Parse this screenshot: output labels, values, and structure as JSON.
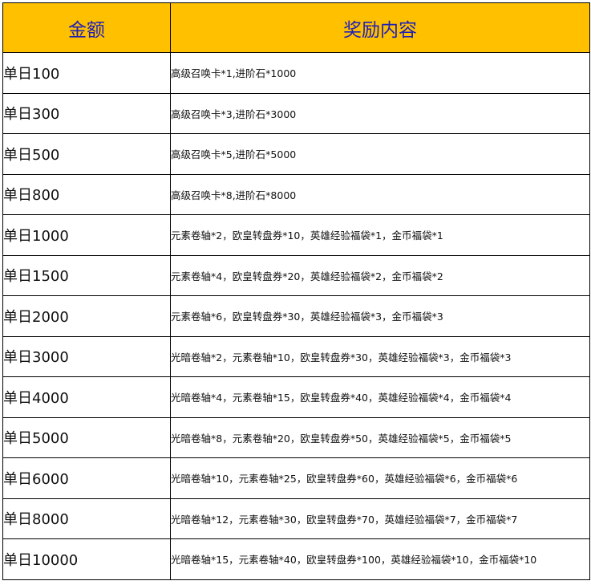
{
  "header": {
    "amount_label": "金额",
    "reward_label": "奖励内容"
  },
  "colors": {
    "header_bg": "#ffc000",
    "header_text": "#1f1fb8",
    "border": "#000000"
  },
  "rows": [
    {
      "amount": "单日100",
      "reward": "高级召唤卡*1,进阶石*1000"
    },
    {
      "amount": "单日300",
      "reward": "高级召唤卡*3,进阶石*3000"
    },
    {
      "amount": "单日500",
      "reward": "高级召唤卡*5,进阶石*5000"
    },
    {
      "amount": "单日800",
      "reward": "高级召唤卡*8,进阶石*8000"
    },
    {
      "amount": "单日1000",
      "reward": "元素卷轴*2，欧皇转盘券*10，英雄经验福袋*1，金币福袋*1"
    },
    {
      "amount": "单日1500",
      "reward": "元素卷轴*4，欧皇转盘券*20，英雄经验福袋*2，金币福袋*2"
    },
    {
      "amount": "单日2000",
      "reward": "元素卷轴*6，欧皇转盘券*30，英雄经验福袋*3，金币福袋*3"
    },
    {
      "amount": "单日3000",
      "reward": "光暗卷轴*2，元素卷轴*10，欧皇转盘券*30，英雄经验福袋*3，金币福袋*3"
    },
    {
      "amount": "单日4000",
      "reward": "光暗卷轴*4，元素卷轴*15，欧皇转盘券*40，英雄经验福袋*4，金币福袋*4"
    },
    {
      "amount": "单日5000",
      "reward": "光暗卷轴*8，元素卷轴*20，欧皇转盘券*50，英雄经验福袋*5，金币福袋*5"
    },
    {
      "amount": "单日6000",
      "reward": "光暗卷轴*10，元素卷轴*25，欧皇转盘券*60，英雄经验福袋*6，金币福袋*6"
    },
    {
      "amount": "单日8000",
      "reward": "光暗卷轴*12，元素卷轴*30，欧皇转盘券*70，英雄经验福袋*7，金币福袋*7"
    },
    {
      "amount": "单日10000",
      "reward": "光暗卷轴*15，元素卷轴*40，欧皇转盘券*100，英雄经验福袋*10，金币福袋*10"
    }
  ]
}
